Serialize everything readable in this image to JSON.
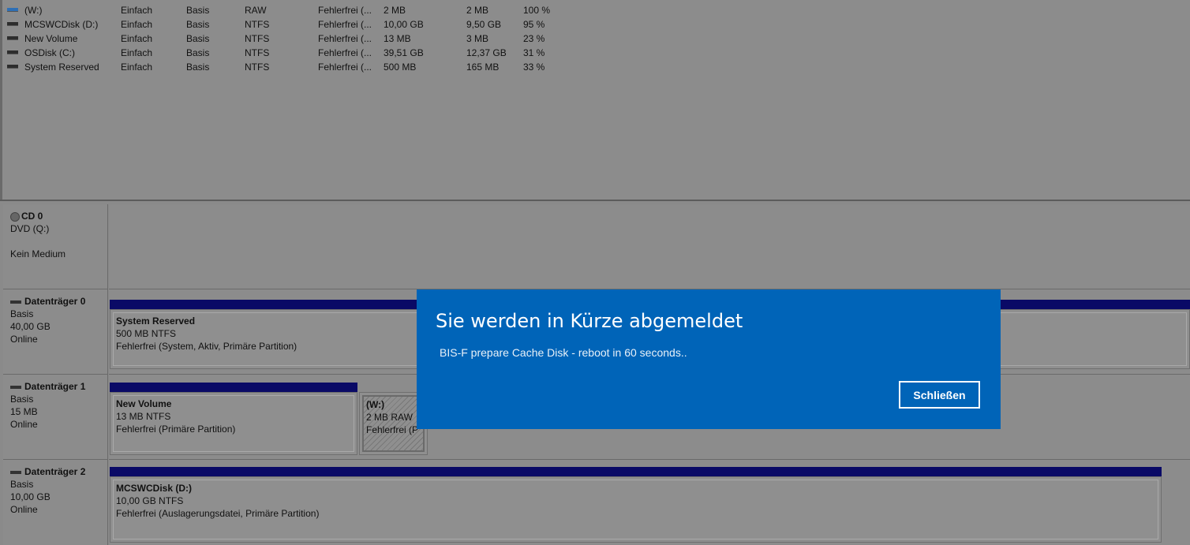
{
  "volumes": [
    {
      "name": "(W:)",
      "layout": "Einfach",
      "type": "Basis",
      "fs": "RAW",
      "status": "Fehlerfrei (...",
      "capacity": "2 MB",
      "free": "2 MB",
      "pct_free": "100 %",
      "icon": "volume-icon-blue"
    },
    {
      "name": "MCSWCDisk (D:)",
      "layout": "Einfach",
      "type": "Basis",
      "fs": "NTFS",
      "status": "Fehlerfrei (...",
      "capacity": "10,00 GB",
      "free": "9,50 GB",
      "pct_free": "95 %",
      "icon": "volume-icon"
    },
    {
      "name": "New Volume",
      "layout": "Einfach",
      "type": "Basis",
      "fs": "NTFS",
      "status": "Fehlerfrei (...",
      "capacity": "13 MB",
      "free": "3 MB",
      "pct_free": "23 %",
      "icon": "volume-icon"
    },
    {
      "name": "OSDisk (C:)",
      "layout": "Einfach",
      "type": "Basis",
      "fs": "NTFS",
      "status": "Fehlerfrei (...",
      "capacity": "39,51 GB",
      "free": "12,37 GB",
      "pct_free": "31 %",
      "icon": "volume-icon"
    },
    {
      "name": "System Reserved",
      "layout": "Einfach",
      "type": "Basis",
      "fs": "NTFS",
      "status": "Fehlerfrei (...",
      "capacity": "500 MB",
      "free": "165 MB",
      "pct_free": "33 %",
      "icon": "volume-icon"
    }
  ],
  "cd": {
    "title": "CD 0",
    "line1": "DVD (Q:)",
    "line2": "Kein Medium",
    "icon": "cd-drive-icon"
  },
  "disks": [
    {
      "title": "Datenträger 0",
      "type": "Basis",
      "size": "40,00 GB",
      "state": "Online",
      "partitions": [
        {
          "name": "System Reserved",
          "detail": "500 MB NTFS",
          "status": "Fehlerfrei (System, Aktiv, Primäre Partition)"
        }
      ]
    },
    {
      "title": "Datenträger 1",
      "type": "Basis",
      "size": "15 MB",
      "state": "Online",
      "partitions": [
        {
          "name": "New Volume",
          "detail": "13 MB NTFS",
          "status": "Fehlerfrei (Primäre Partition)"
        },
        {
          "name": "(W:)",
          "detail": "2 MB RAW",
          "status": "Fehlerfrei (P"
        }
      ]
    },
    {
      "title": "Datenträger 2",
      "type": "Basis",
      "size": "10,00 GB",
      "state": "Online",
      "partitions": [
        {
          "name": "MCSWCDisk  (D:)",
          "detail": "10,00 GB NTFS",
          "status": "Fehlerfrei (Auslagerungsdatei, Primäre Partition)"
        }
      ]
    }
  ],
  "toast": {
    "title": "Sie werden in Kürze abgemeldet",
    "message": "BIS-F prepare Cache Disk - reboot in 60 seconds..",
    "button": "Schließen",
    "accent": "#0064b8"
  },
  "colors": {
    "partition_bar": "#0a0a66"
  }
}
